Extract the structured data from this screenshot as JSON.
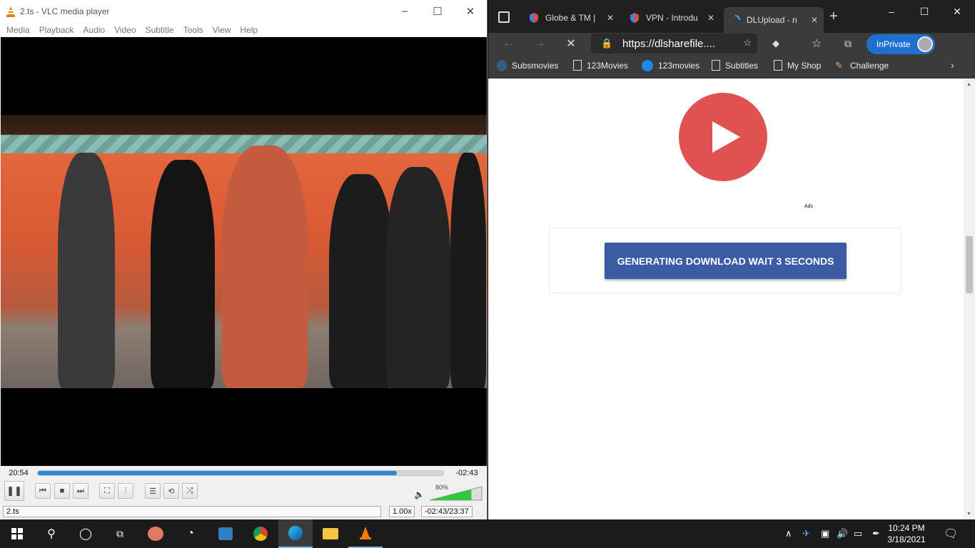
{
  "vlc": {
    "title": "2.ts - VLC media player",
    "menu": [
      "Media",
      "Playback",
      "Audio",
      "Video",
      "Subtitle",
      "Tools",
      "View",
      "Help"
    ],
    "elapsed": "20:54",
    "remaining": "-02:43",
    "progress": 0.885,
    "volume_percent": "80%",
    "volume_level": 0.8,
    "status_file": "2.ts",
    "status_speed": "1.00x",
    "status_time": "-02:43/23:37"
  },
  "edge": {
    "tabs": [
      {
        "label": "Globe & TM |",
        "icon": "vpn-shield-icon"
      },
      {
        "label": "VPN - Introdu",
        "icon": "vpn-shield-icon"
      },
      {
        "label": "DLUpload - n",
        "icon": "loading-spinner-icon"
      }
    ],
    "address": "https://dlsharefile....",
    "inprivate_label": "InPrivate",
    "favorites": [
      {
        "label": "Subsmovies",
        "icon": "site-icon"
      },
      {
        "label": "123Movies",
        "icon": "page-icon"
      },
      {
        "label": "123movies",
        "icon": "play-icon"
      },
      {
        "label": "Subtitles",
        "icon": "page-icon"
      },
      {
        "label": "My Shop",
        "icon": "page-icon"
      },
      {
        "label": "Challenge",
        "icon": "pencil-icon"
      }
    ],
    "page": {
      "ads_label": "Ads",
      "download_button": "GENERATING DOWNLOAD WAIT 3 SECONDS"
    }
  },
  "taskbar": {
    "time": "10:24 PM",
    "date": "3/18/2021",
    "accent": "#76b9ed"
  }
}
